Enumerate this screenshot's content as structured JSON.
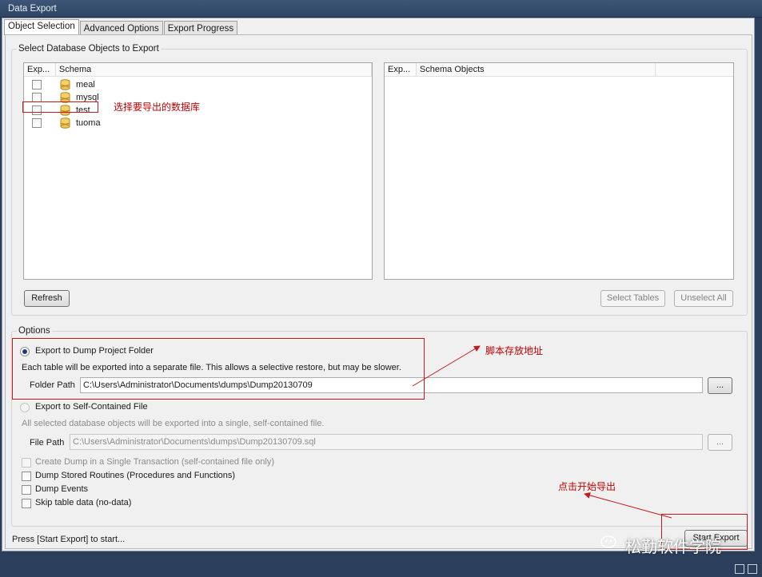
{
  "window": {
    "title": "Data Export"
  },
  "tabs": [
    {
      "label": "Object Selection",
      "active": true
    },
    {
      "label": "Advanced Options",
      "active": false
    },
    {
      "label": "Export Progress",
      "active": false
    }
  ],
  "selection_group": {
    "title": "Select Database Objects to Export"
  },
  "schema_list": {
    "columns": [
      "Exp...",
      "Schema"
    ],
    "rows": [
      {
        "name": "meal",
        "checked": false
      },
      {
        "name": "mysql",
        "checked": false
      },
      {
        "name": "test",
        "checked": false
      },
      {
        "name": "tuoma",
        "checked": false
      }
    ]
  },
  "objects_list": {
    "columns": [
      "Exp...",
      "Schema Objects"
    ]
  },
  "buttons": {
    "refresh": "Refresh",
    "select_tables": "Select Tables",
    "unselect_all": "Unselect All",
    "browse_folder": "...",
    "browse_file": "...",
    "start_export": "Start Export"
  },
  "options": {
    "title": "Options",
    "dump_folder": {
      "label": "Export to Dump Project Folder",
      "selected": true,
      "description": "Each table will be exported into a separate file. This allows a selective restore, but may be slower.",
      "path_label": "Folder Path",
      "path_value": "C:\\Users\\Administrator\\Documents\\dumps\\Dump20130709"
    },
    "self_contained": {
      "label": "Export to Self-Contained File",
      "selected": false,
      "description": "All selected database objects will be exported into a single, self-contained file.",
      "path_label": "File Path",
      "path_value": "C:\\Users\\Administrator\\Documents\\dumps\\Dump20130709.sql"
    },
    "checkboxes": [
      {
        "label": "Create Dump in a Single Transaction (self-contained file only)",
        "checked": false,
        "enabled": false
      },
      {
        "label": "Dump Stored Routines (Procedures and Functions)",
        "checked": false,
        "enabled": true
      },
      {
        "label": "Dump Events",
        "checked": false,
        "enabled": true
      },
      {
        "label": "Skip table data (no-data)",
        "checked": false,
        "enabled": true
      }
    ]
  },
  "status": {
    "text": "Press [Start Export] to start..."
  },
  "annotations": {
    "select_db": "选择要导出的数据库",
    "script_path": "脚本存放地址",
    "click_start": "点击开始导出"
  },
  "watermark": {
    "text": "松勤软件学院"
  },
  "colors": {
    "annotation": "#c00000",
    "titlebar": "#2e4564",
    "radio_dot": "#1d3d7a"
  }
}
